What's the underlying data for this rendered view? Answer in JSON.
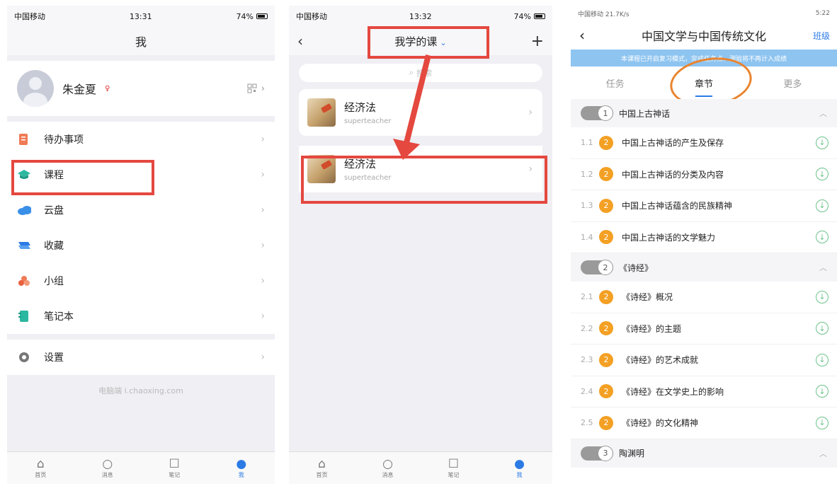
{
  "panel1": {
    "status": {
      "carrier": "中国移动",
      "time": "13:31",
      "battery": "74%"
    },
    "title": "我",
    "profile": {
      "name": "朱金夏",
      "gender_mark": "♀"
    },
    "menu": [
      {
        "label": "待办事项",
        "icon": "todo-icon",
        "color": "#f07a56"
      },
      {
        "label": "课程",
        "icon": "course-icon",
        "color": "#2bb7a0"
      },
      {
        "label": "云盘",
        "icon": "cloud-icon",
        "color": "#3a8fe8"
      },
      {
        "label": "收藏",
        "icon": "favorite-icon",
        "color": "#2c7be5"
      },
      {
        "label": "小组",
        "icon": "group-icon",
        "color": "#f07a56"
      },
      {
        "label": "笔记本",
        "icon": "notebook-icon",
        "color": "#2bb7a0"
      }
    ],
    "settings": "设置",
    "footer": "电脑端 i.chaoxing.com"
  },
  "tabbar": [
    {
      "label": "首页",
      "icon": "home-icon"
    },
    {
      "label": "消息",
      "icon": "message-icon"
    },
    {
      "label": "笔记",
      "icon": "note-icon"
    },
    {
      "label": "我",
      "icon": "user-icon"
    }
  ],
  "panel2": {
    "status": {
      "carrier": "中国移动",
      "time": "13:32",
      "battery": "74%"
    },
    "title": "我学的课",
    "search_placeholder": "搜索",
    "courses": [
      {
        "title": "经济法",
        "teacher": "superteacher"
      },
      {
        "title": "经济法",
        "teacher": "superteacher"
      }
    ]
  },
  "panel3": {
    "status": {
      "left": "中国移动 21.7K/s",
      "right": "5:22"
    },
    "title": "中国文学与中国传统文化",
    "class_link": "班级",
    "notice": "本课程已开启复习模式，完成任务点、测验将不再计入成绩",
    "tabs": [
      "任务",
      "章节",
      "更多"
    ],
    "chapters": [
      {
        "no": "1",
        "title": "中国上古神话",
        "sections": [
          {
            "no": "1.1",
            "badge": "2",
            "title": "中国上古神话的产生及保存"
          },
          {
            "no": "1.2",
            "badge": "2",
            "title": "中国上古神话的分类及内容"
          },
          {
            "no": "1.3",
            "badge": "2",
            "title": "中国上古神话蕴含的民族精神"
          },
          {
            "no": "1.4",
            "badge": "2",
            "title": "中国上古神话的文学魅力"
          }
        ]
      },
      {
        "no": "2",
        "title": "《诗经》",
        "sections": [
          {
            "no": "2.1",
            "badge": "2",
            "title": "《诗经》概况"
          },
          {
            "no": "2.2",
            "badge": "2",
            "title": "《诗经》的主题"
          },
          {
            "no": "2.3",
            "badge": "2",
            "title": "《诗经》的艺术成就"
          },
          {
            "no": "2.4",
            "badge": "2",
            "title": "《诗经》在文学史上的影响"
          },
          {
            "no": "2.5",
            "badge": "2",
            "title": "《诗经》的文化精神"
          }
        ]
      },
      {
        "no": "3",
        "title": "陶渊明",
        "sections": []
      }
    ]
  }
}
